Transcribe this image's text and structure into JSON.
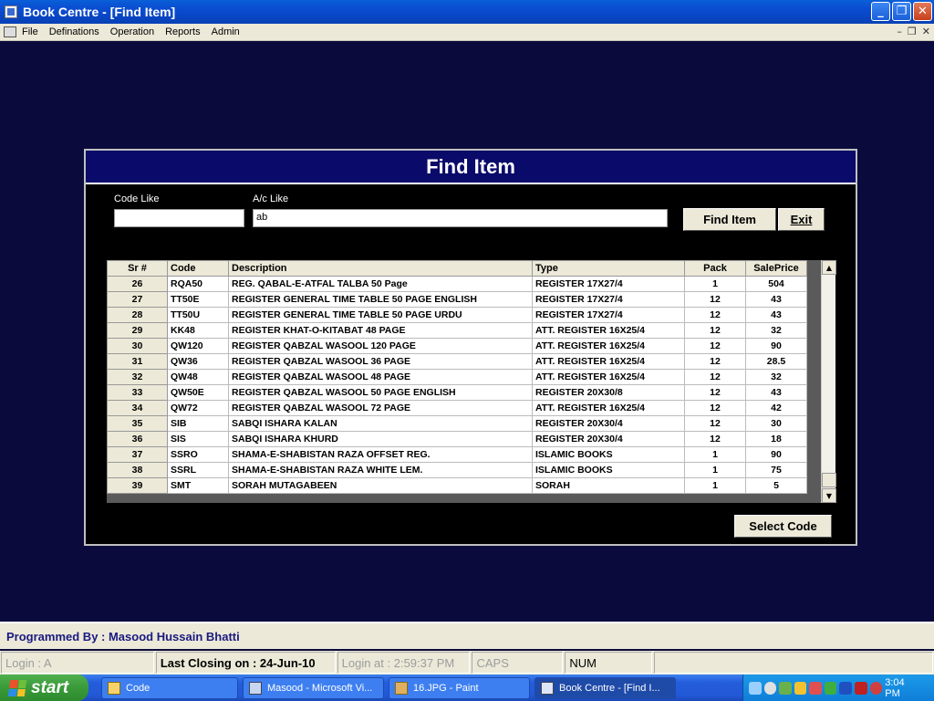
{
  "window": {
    "title": "Book Centre  - [Find Item]"
  },
  "menu": [
    "File",
    "Definations",
    "Operation",
    "Reports",
    "Admin"
  ],
  "dialog": {
    "title": "Find Item",
    "code_like_label": "Code Like",
    "code_like_value": "",
    "ac_like_label": "A/c Like",
    "ac_like_value": "ab",
    "find_button": "Find Item",
    "exit_button": "Exit",
    "select_button": "Select Code"
  },
  "grid": {
    "columns": [
      "Sr #",
      "Code",
      "Description",
      "Type",
      "Pack",
      "SalePrice"
    ],
    "rows": [
      [
        "26",
        "RQA50",
        "REG. QABAL-E-ATFAL TALBA 50 Page",
        "REGISTER 17X27/4",
        "1",
        "504"
      ],
      [
        "27",
        "TT50E",
        "REGISTER GENERAL TIME TABLE 50 PAGE ENGLISH",
        "REGISTER 17X27/4",
        "12",
        "43"
      ],
      [
        "28",
        "TT50U",
        "REGISTER GENERAL TIME TABLE 50 PAGE URDU",
        "REGISTER 17X27/4",
        "12",
        "43"
      ],
      [
        "29",
        "KK48",
        "REGISTER KHAT-O-KITABAT 48 PAGE",
        "ATT. REGISTER 16X25/4",
        "12",
        "32"
      ],
      [
        "30",
        "QW120",
        "REGISTER QABZAL WASOOL 120 PAGE",
        "ATT. REGISTER 16X25/4",
        "12",
        "90"
      ],
      [
        "31",
        "QW36",
        "REGISTER QABZAL WASOOL 36 PAGE",
        "ATT. REGISTER 16X25/4",
        "12",
        "28.5"
      ],
      [
        "32",
        "QW48",
        "REGISTER QABZAL WASOOL 48 PAGE",
        "ATT. REGISTER 16X25/4",
        "12",
        "32"
      ],
      [
        "33",
        "QW50E",
        "REGISTER QABZAL WASOOL 50 PAGE ENGLISH",
        "REGISTER 20X30/8",
        "12",
        "43"
      ],
      [
        "34",
        "QW72",
        "REGISTER QABZAL WASOOL 72 PAGE",
        "ATT. REGISTER 16X25/4",
        "12",
        "42"
      ],
      [
        "35",
        "SIB",
        "SABQI ISHARA KALAN",
        "REGISTER 20X30/4",
        "12",
        "30"
      ],
      [
        "36",
        "SIS",
        "SABQI ISHARA KHURD",
        "REGISTER 20X30/4",
        "12",
        "18"
      ],
      [
        "37",
        "SSRO",
        "SHAMA-E-SHABISTAN RAZA OFFSET REG.",
        "ISLAMIC BOOKS",
        "1",
        "90"
      ],
      [
        "38",
        "SSRL",
        "SHAMA-E-SHABISTAN RAZA WHITE LEM.",
        "ISLAMIC BOOKS",
        "1",
        "75"
      ],
      [
        "39",
        "SMT",
        "SORAH MUTAGABEEN",
        "SORAH",
        "1",
        "5"
      ]
    ]
  },
  "footer": {
    "programmer": "Programmed By : Masood Hussain Bhatti",
    "login": "Login :  A",
    "last_closing": "Last Closing on : 24-Jun-10",
    "login_at": "Login at : 2:59:37 PM",
    "caps": "CAPS",
    "num": "NUM"
  },
  "taskbar": {
    "start": "start",
    "tasks": [
      "Code",
      "Masood - Microsoft Vi...",
      "16.JPG - Paint",
      "Book Centre  - [Find I..."
    ],
    "clock": "3:04 PM"
  }
}
